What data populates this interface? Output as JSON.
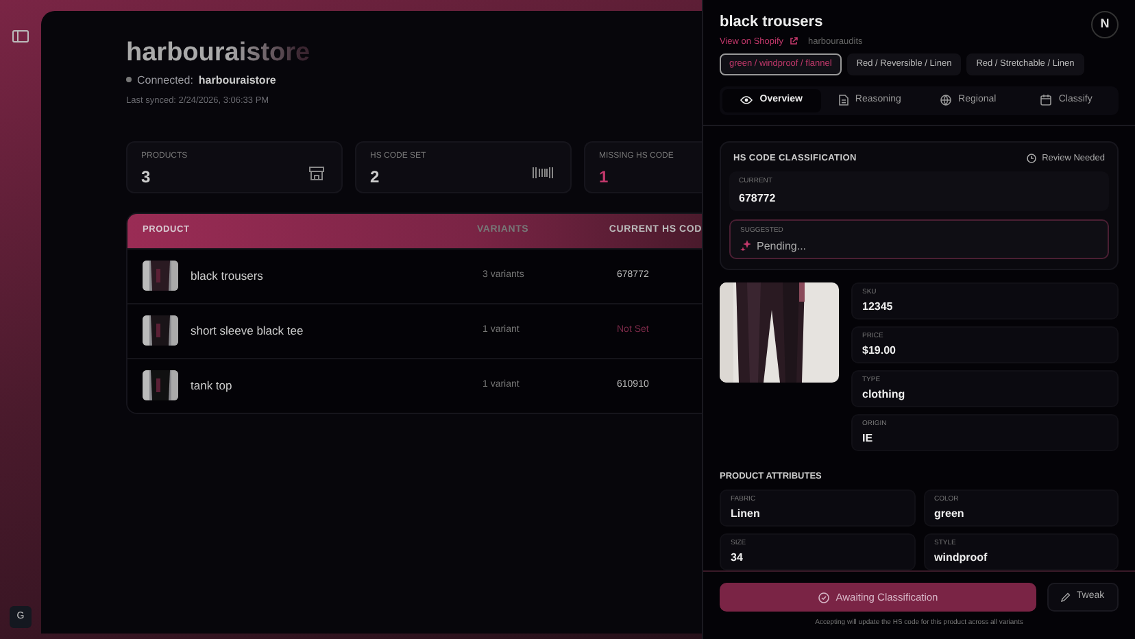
{
  "sidebar": {
    "footer_initial": "G"
  },
  "store": {
    "name": "harbouraistore",
    "connection": "Connected: **harbouraistore**",
    "last_synced": "Last synced: 2/24/2026, 3:06:33 PM"
  },
  "stats": [
    {
      "label": "PRODUCTS",
      "value": "3",
      "kind": "store",
      "alert": false
    },
    {
      "label": "HS CODE SET",
      "value": "2",
      "kind": "barcode",
      "alert": false
    },
    {
      "label": "MISSING HS CODE",
      "value": "1",
      "kind": "none",
      "alert": true
    }
  ],
  "table": {
    "columns": [
      "PRODUCT",
      "VARIANTS",
      "CURRENT HS COD"
    ],
    "rows": [
      {
        "product": "black trousers",
        "variants": "3 variants",
        "hs_code": "678772",
        "hs_set": true
      },
      {
        "product": "short sleeve black tee",
        "variants": "1 variant",
        "hs_code": "Not Set",
        "hs_set": false
      },
      {
        "product": "tank top",
        "variants": "1 variant",
        "hs_code": "610910",
        "hs_set": true
      }
    ]
  },
  "drawer": {
    "title": "black trousers",
    "shopify_link": "View on Shopify",
    "store": "harbouraudits",
    "avatar": "N",
    "variants": [
      {
        "label": "green / windproof / flannel",
        "selected": true
      },
      {
        "label": "Red / Reversible / Linen",
        "selected": false
      },
      {
        "label": "Red / Stretchable / Linen",
        "selected": false
      }
    ],
    "tabs": [
      {
        "label": "Overview",
        "kind": "eye",
        "selected": true
      },
      {
        "label": "Reasoning",
        "kind": "doc",
        "selected": false
      },
      {
        "label": "Regional",
        "kind": "globe",
        "selected": false
      },
      {
        "label": "Classify",
        "kind": "calendar",
        "selected": false
      }
    ],
    "classification": {
      "title": "HS CODE CLASSIFICATION",
      "status": "Review Needed",
      "current_label": "CURRENT",
      "current_value": "678772",
      "suggested_label": "SUGGESTED",
      "suggested_value": "Pending..."
    },
    "details": [
      {
        "label": "SKU",
        "value": "12345"
      },
      {
        "label": "PRICE",
        "value": "$19.00"
      },
      {
        "label": "TYPE",
        "value": "clothing"
      },
      {
        "label": "ORIGIN",
        "value": "IE"
      }
    ],
    "attributes_title": "PRODUCT ATTRIBUTES",
    "attributes": [
      {
        "label": "FABRIC",
        "value": "Linen"
      },
      {
        "label": "COLOR",
        "value": "green"
      },
      {
        "label": "SIZE",
        "value": "34"
      },
      {
        "label": "STYLE",
        "value": "windproof"
      }
    ],
    "primary_button": "Awaiting Classification",
    "secondary_button": "Tweak",
    "note": "Accepting will update the HS code for this product across all variants"
  }
}
